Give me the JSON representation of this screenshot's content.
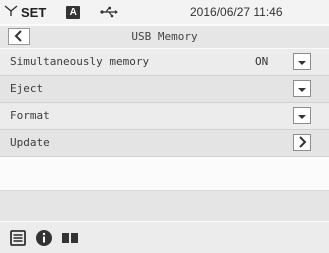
{
  "status": {
    "mode": "SET",
    "a_badge": "A",
    "datetime": "2016/06/27 11:46",
    "icons": [
      "signal-icon",
      "auto-mode-icon",
      "usb-icon"
    ]
  },
  "header": {
    "title": "USB Memory",
    "back_icon": "chevron-left-icon"
  },
  "menu": {
    "items": [
      {
        "label": "Simultaneously memory",
        "value": "ON",
        "icon": "chevron-down-icon"
      },
      {
        "label": "Eject",
        "value": "",
        "icon": "chevron-down-icon"
      },
      {
        "label": "Format",
        "value": "",
        "icon": "chevron-down-icon"
      },
      {
        "label": "Update",
        "value": "",
        "icon": "chevron-right-icon"
      }
    ]
  },
  "bottom_bar": {
    "icons": [
      "list-icon",
      "info-icon",
      "book-icon"
    ]
  },
  "colors": {
    "background": "#fbfbfb",
    "row": "#e9e9e9",
    "icon_dark": "#3a3a3a"
  }
}
